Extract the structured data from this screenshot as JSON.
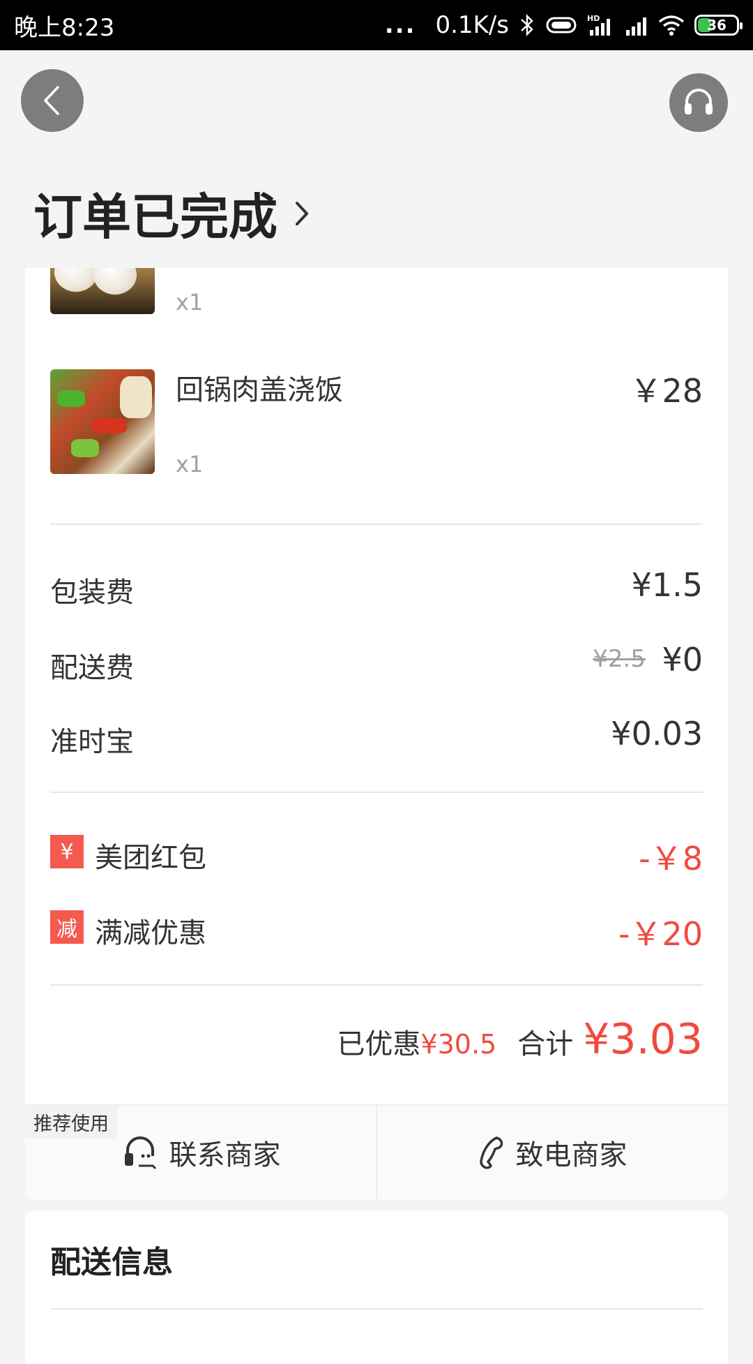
{
  "status_bar": {
    "time": "晚上8:23",
    "dots": "...",
    "net_speed": "0.1K/s",
    "battery": "36",
    "battery_level_percent": 36,
    "icons": [
      "bluetooth-icon",
      "vibrate-icon",
      "hd-signal-icon",
      "signal-icon",
      "wifi-icon",
      "battery-icon"
    ]
  },
  "nav": {
    "back_icon": "back-arrow-icon",
    "service_icon": "headset-icon"
  },
  "order": {
    "status_title": "订单已完成"
  },
  "items": [
    {
      "name": "",
      "qty": "x1",
      "price": ""
    },
    {
      "name": "回锅肉盖浇饭",
      "qty": "x1",
      "price": "￥28"
    }
  ],
  "fees": {
    "packaging_label": "包装费",
    "packaging_value": "¥1.5",
    "delivery_label": "配送费",
    "delivery_original": "¥2.5",
    "delivery_value": "¥0",
    "ontime_label": "准时宝",
    "ontime_value": "¥0.03"
  },
  "promos": [
    {
      "badge": "¥",
      "label": "美团红包",
      "value": "-￥8"
    },
    {
      "badge": "减",
      "label": "满减优惠",
      "value": "-￥20"
    }
  ],
  "summary": {
    "discount_label": "已优惠",
    "discount_value": "¥30.5",
    "total_label": "合计",
    "total_value": "¥3.03"
  },
  "actions": {
    "recommend_tag": "推荐使用",
    "contact_label": "联系商家",
    "call_label": "致电商家"
  },
  "delivery_info": {
    "title": "配送信息"
  },
  "colors": {
    "accent_red": "#f04a3e",
    "badge_red": "#f55a4e",
    "background": "#f4f4f4"
  }
}
